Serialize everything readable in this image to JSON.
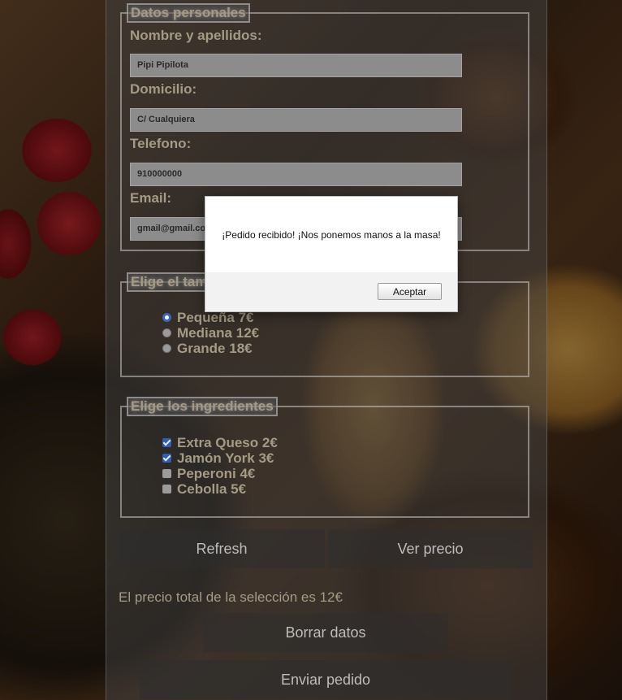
{
  "personal": {
    "legend": "Datos personales",
    "fields": [
      {
        "label": "Nombre y apellidos:",
        "value": "Pipi Pipilota"
      },
      {
        "label": "Domicilio:",
        "value": "C/ Cualquiera"
      },
      {
        "label": "Telefono:",
        "value": "910000000"
      },
      {
        "label": "Email:",
        "value": "gmail@gmail.com"
      }
    ]
  },
  "size": {
    "legend": "Elige el tamaño de tu pizza",
    "options": [
      {
        "label": "Pequeña 7€",
        "selected": true
      },
      {
        "label": "Mediana 12€",
        "selected": false
      },
      {
        "label": "Grande 18€",
        "selected": false
      }
    ]
  },
  "ingredients": {
    "legend": "Elige los ingredientes",
    "options": [
      {
        "label": "Extra Queso 2€",
        "checked": true
      },
      {
        "label": "Jamón York 3€",
        "checked": true
      },
      {
        "label": "Peperoni 4€",
        "checked": false
      },
      {
        "label": "Cebolla 5€",
        "checked": false
      }
    ]
  },
  "actions": {
    "refresh": "Refresh",
    "price": "Ver precio",
    "total_text": "El precio total de la selección es 12€",
    "clear": "Borrar datos",
    "submit": "Enviar pedido"
  },
  "alert": {
    "message": "¡Pedido recibido! ¡Nos ponemos manos a la masa!",
    "ok_label": "Aceptar"
  },
  "colors": {
    "text": "#a59a83",
    "radio_selected": "#3a68b8",
    "checkbox_checked": "#2f5fb0"
  }
}
